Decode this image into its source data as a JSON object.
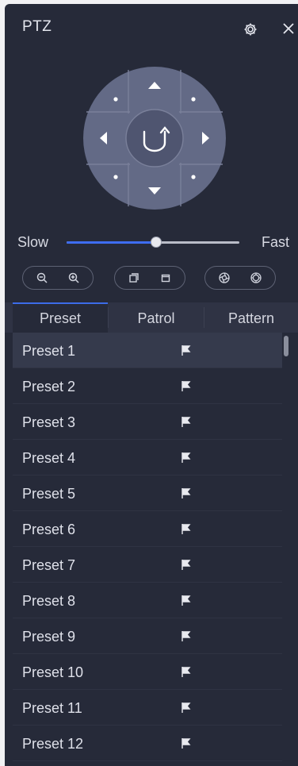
{
  "header": {
    "title": "PTZ",
    "settings_icon": "gear-icon",
    "close_icon": "close-icon"
  },
  "direction_pad": {
    "center_icon": "rotate-icon",
    "buttons": [
      "up-left",
      "up",
      "up-right",
      "left",
      "auto-rotate",
      "right",
      "down-left",
      "down",
      "down-right"
    ]
  },
  "speed": {
    "slow_label": "Slow",
    "fast_label": "Fast",
    "value": 0.52
  },
  "lens_controls": [
    {
      "group": "zoom",
      "icons": [
        "zoom-out-icon",
        "zoom-in-icon"
      ]
    },
    {
      "group": "focus",
      "icons": [
        "focus-near-icon",
        "focus-far-icon"
      ]
    },
    {
      "group": "iris",
      "icons": [
        "iris-open-icon",
        "iris-close-icon"
      ]
    }
  ],
  "tabs": {
    "items": [
      {
        "label": "Preset",
        "active": true
      },
      {
        "label": "Patrol",
        "active": false
      },
      {
        "label": "Pattern",
        "active": false
      }
    ]
  },
  "presets": {
    "selected_index": 0,
    "items": [
      {
        "name": "Preset 1",
        "icon": "flag-icon"
      },
      {
        "name": "Preset 2",
        "icon": "flag-icon"
      },
      {
        "name": "Preset 3",
        "icon": "flag-icon"
      },
      {
        "name": "Preset 4",
        "icon": "flag-icon"
      },
      {
        "name": "Preset 5",
        "icon": "flag-icon"
      },
      {
        "name": "Preset 6",
        "icon": "flag-icon"
      },
      {
        "name": "Preset 7",
        "icon": "flag-icon"
      },
      {
        "name": "Preset 8",
        "icon": "flag-icon"
      },
      {
        "name": "Preset 9",
        "icon": "flag-icon"
      },
      {
        "name": "Preset 10",
        "icon": "flag-icon"
      },
      {
        "name": "Preset 11",
        "icon": "flag-icon"
      },
      {
        "name": "Preset 12",
        "icon": "flag-icon"
      }
    ]
  },
  "colors": {
    "panel_bg": "#262a39",
    "accent": "#3e6df0",
    "dpad_outer": "#636a86",
    "dpad_inner": "#4f5570"
  }
}
